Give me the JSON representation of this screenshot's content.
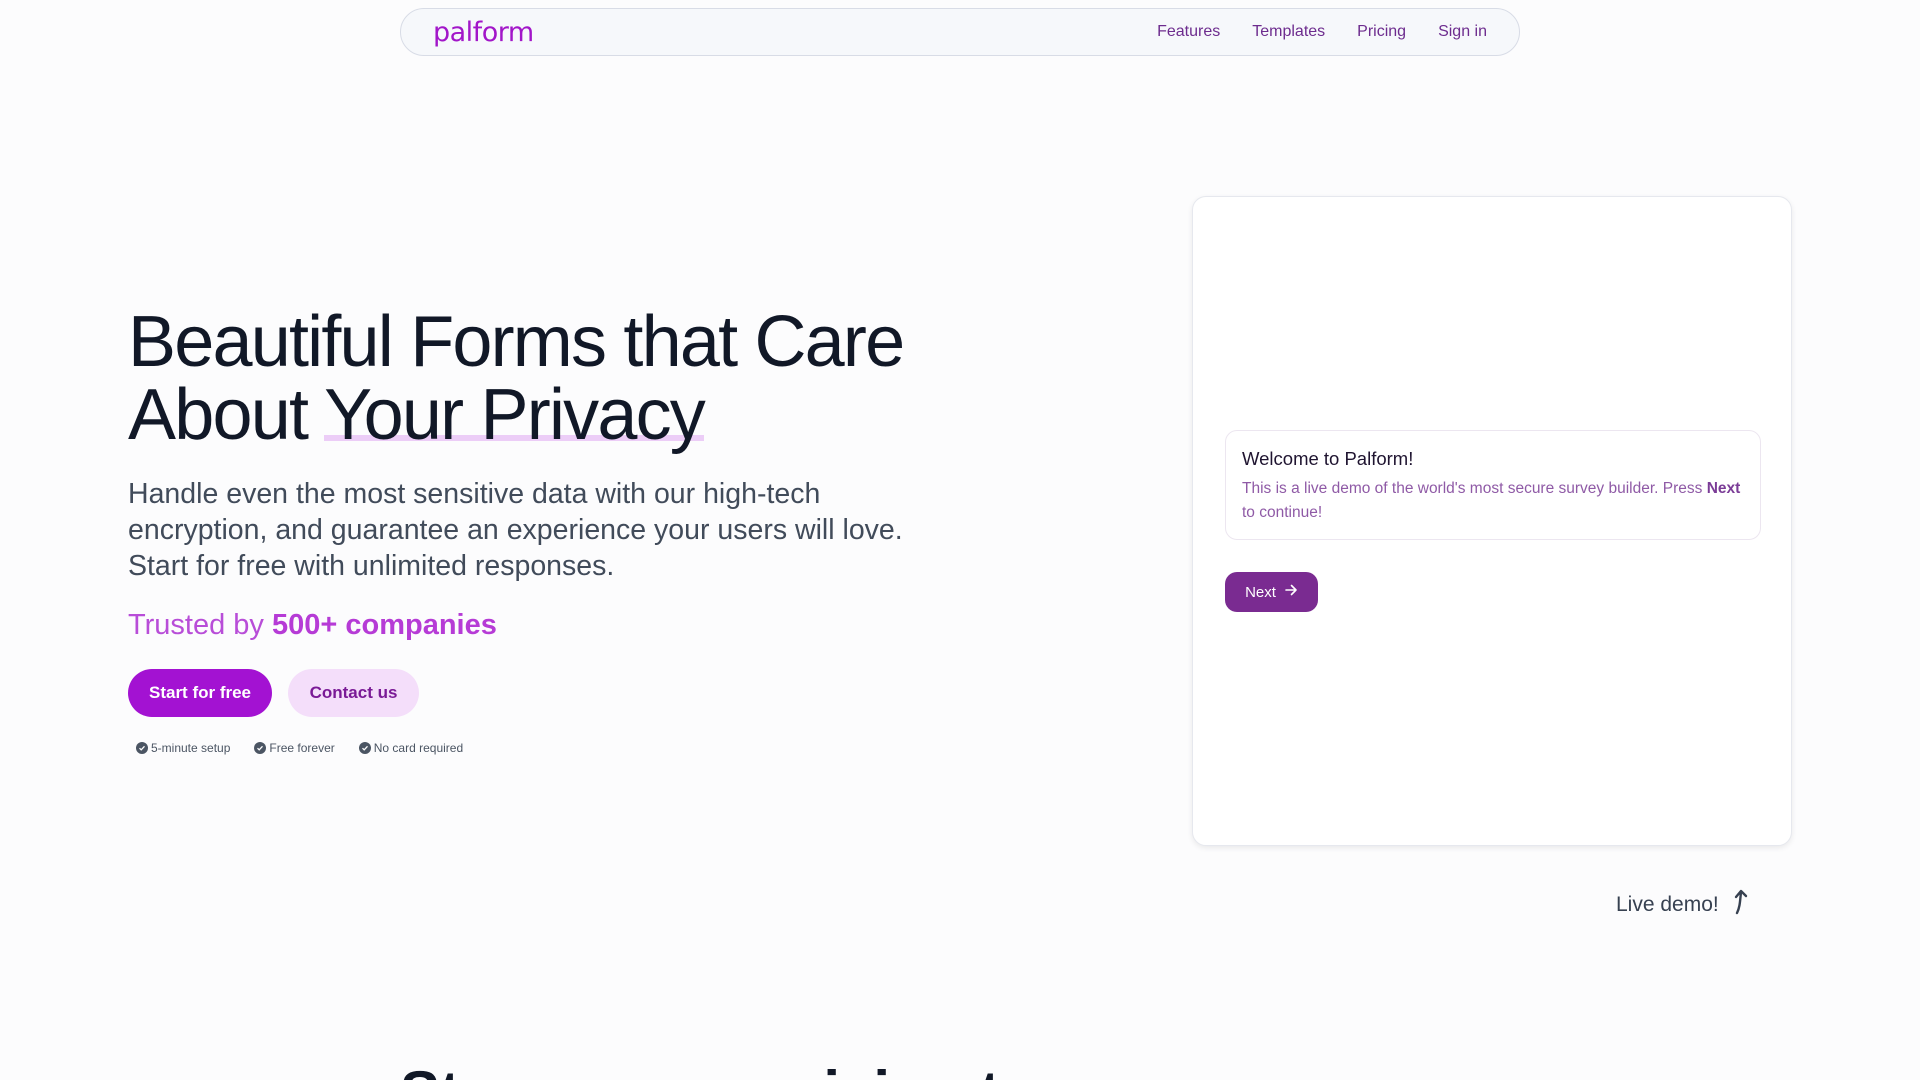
{
  "nav": {
    "logo": "palform",
    "links": [
      "Features",
      "Templates",
      "Pricing",
      "Sign in"
    ]
  },
  "hero": {
    "title_line1": "Beautiful Forms that Care",
    "title_line2_plain": "About ",
    "title_line2_underlined": "Your Privacy",
    "subtitle": "Handle even the most sensitive data with our high-tech encryption, and guarantee an experience your users will love. Start for free with unlimited responses.",
    "trusted_prefix": "Trusted by ",
    "trusted_bold": "500+ companies",
    "primary_button": "Start for free",
    "secondary_button": "Contact us",
    "checks": [
      "5-minute setup",
      "Free forever",
      "No card required"
    ]
  },
  "demo": {
    "message_title": "Welcome to Palform!",
    "message_body_1": "This is a live demo of the world's most secure survey builder. Press ",
    "message_body_bold": "Next",
    "message_body_2": " to continue!",
    "next_button": "Next",
    "live_demo_label": "Live demo!"
  },
  "section": {
    "heading": "Stop compromising to survey"
  },
  "colors": {
    "brand": "#a312d2",
    "brand_light": "#f4defa",
    "demo_button": "#7a2b91"
  }
}
